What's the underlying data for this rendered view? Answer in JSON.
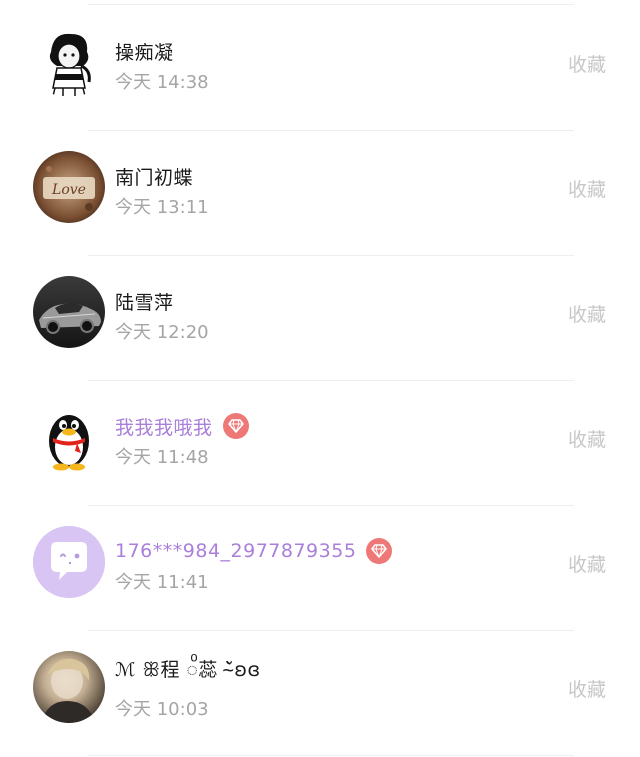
{
  "items": [
    {
      "name": "操痴凝",
      "time": "今天 14:38",
      "action": "收藏",
      "vip": false,
      "avatar": "bw-cartoon-girl-avatar"
    },
    {
      "name": "南门初蝶",
      "time": "今天 13:11",
      "action": "收藏",
      "vip": false,
      "avatar": "love-sign-avatar"
    },
    {
      "name": "陆雪萍",
      "time": "今天 12:20",
      "action": "收藏",
      "vip": false,
      "avatar": "sports-car-avatar"
    },
    {
      "name": "我我我哦我",
      "time": "今天 11:48",
      "action": "收藏",
      "vip": true,
      "avatar": "qq-penguin-avatar"
    },
    {
      "name": "176***984_2977879355",
      "time": "今天 11:41",
      "action": "收藏",
      "vip": true,
      "avatar": "chat-bubble-default-avatar"
    },
    {
      "name": "ℳ ꕥ程 ◌ͦ蕊 ˘̴̀ʚɞ",
      "time": "今天 10:03",
      "action": "收藏",
      "vip": false,
      "avatar": "blurred-person-photo-avatar"
    }
  ],
  "colors": {
    "vip_name": "#a97fdb",
    "vip_badge": "#ee7878",
    "time_text": "#a5a5a5",
    "action_text": "#c8c8c8",
    "default_avatar_bg": "#d8c5f3"
  }
}
